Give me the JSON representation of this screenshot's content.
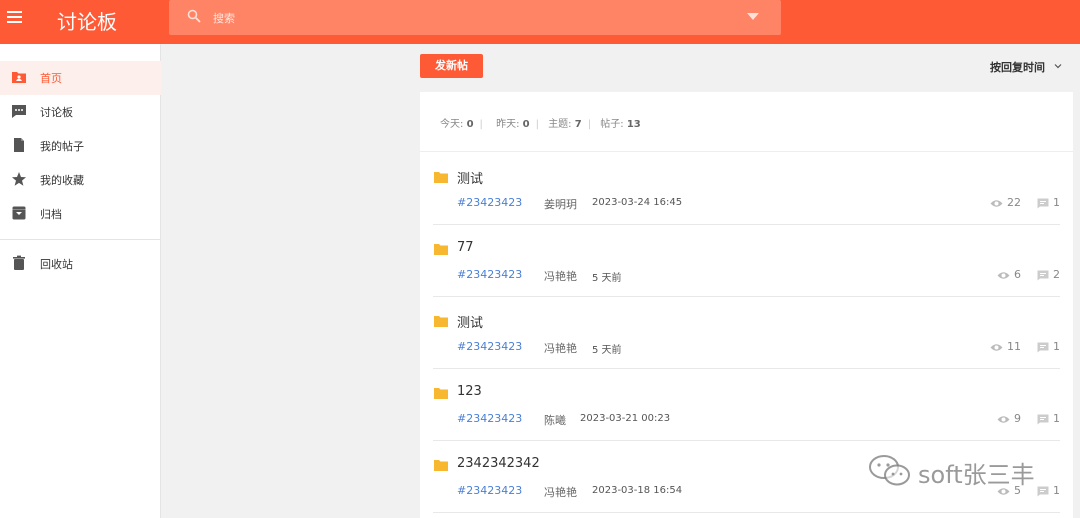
{
  "header": {
    "title": "讨论板",
    "search_placeholder": "搜索"
  },
  "sidebar": {
    "items": [
      {
        "label": "首页",
        "icon": "home-icon",
        "active": true
      },
      {
        "label": "讨论板",
        "icon": "forum-icon",
        "active": false
      },
      {
        "label": "我的帖子",
        "icon": "document-icon",
        "active": false
      },
      {
        "label": "我的收藏",
        "icon": "star-icon",
        "active": false
      },
      {
        "label": "归档",
        "icon": "archive-icon",
        "active": false
      },
      {
        "label": "回收站",
        "icon": "trash-icon",
        "active": false
      }
    ]
  },
  "toolbar": {
    "new_post_label": "发新帖",
    "sort_label": "按回复时间"
  },
  "stats": {
    "today_label": "今天:",
    "today_value": "0",
    "yesterday_label": "昨天:",
    "yesterday_value": "0",
    "topics_label": "主题:",
    "topics_value": "7",
    "posts_label": "帖子:",
    "posts_value": "13"
  },
  "posts": [
    {
      "title": "测试",
      "id": "#23423423",
      "author": "姜明玥",
      "time": "2023-03-24 16:45",
      "views": "22",
      "replies": "1"
    },
    {
      "title": "77",
      "id": "#23423423",
      "author": "冯艳艳",
      "time": "5 天前",
      "views": "6",
      "replies": "2"
    },
    {
      "title": "测试",
      "id": "#23423423",
      "author": "冯艳艳",
      "time": "5 天前",
      "views": "11",
      "replies": "1"
    },
    {
      "title": "123",
      "id": "#23423423",
      "author": "陈曦",
      "time": "2023-03-21 00:23",
      "views": "9",
      "replies": "1"
    },
    {
      "title": "2342342342",
      "id": "#23423423",
      "author": "冯艳艳",
      "time": "2023-03-18 16:54",
      "views": "5",
      "replies": "1"
    }
  ],
  "watermark": {
    "text": "soft张三丰"
  },
  "colors": {
    "brand": "#ff5a36",
    "link": "#4a7fd6",
    "folder": "#f7b731"
  }
}
